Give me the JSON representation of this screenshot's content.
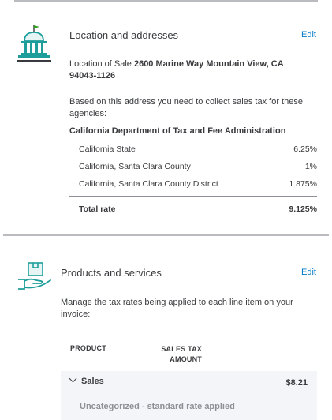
{
  "location": {
    "title": "Location and addresses",
    "edit": "Edit",
    "sale_prefix": "Location of Sale",
    "sale_line1": "2600 Marine Way Mountain View, CA",
    "sale_line2": "94043-1126",
    "info_line1": "Based on this address you need to collect sales tax for these",
    "info_line2": "agencies:",
    "agency": "California Department of Tax and Fee Administration",
    "rates": [
      {
        "name": "California State",
        "rate": "6.25%"
      },
      {
        "name": "California, Santa Clara County",
        "rate": "1%"
      },
      {
        "name": "California, Santa Clara County District",
        "rate": "1.875%"
      }
    ],
    "total_label": "Total rate",
    "total_value": "9.125%"
  },
  "products": {
    "title": "Products and services",
    "edit": "Edit",
    "desc_line1": "Manage the tax rates being applied to each line item on your",
    "desc_line2": "invoice:",
    "col_product": "PRODUCT",
    "col_tax_line1": "SALES TAX",
    "col_tax_line2": "AMOUNT",
    "group_label": "Sales",
    "group_amount": "$8.21",
    "row_label": "Uncategorized - standard rate applied"
  },
  "colors": {
    "accent_teal": "#1e9e9a",
    "link": "#0077c5",
    "flag": "#2ca01c"
  }
}
